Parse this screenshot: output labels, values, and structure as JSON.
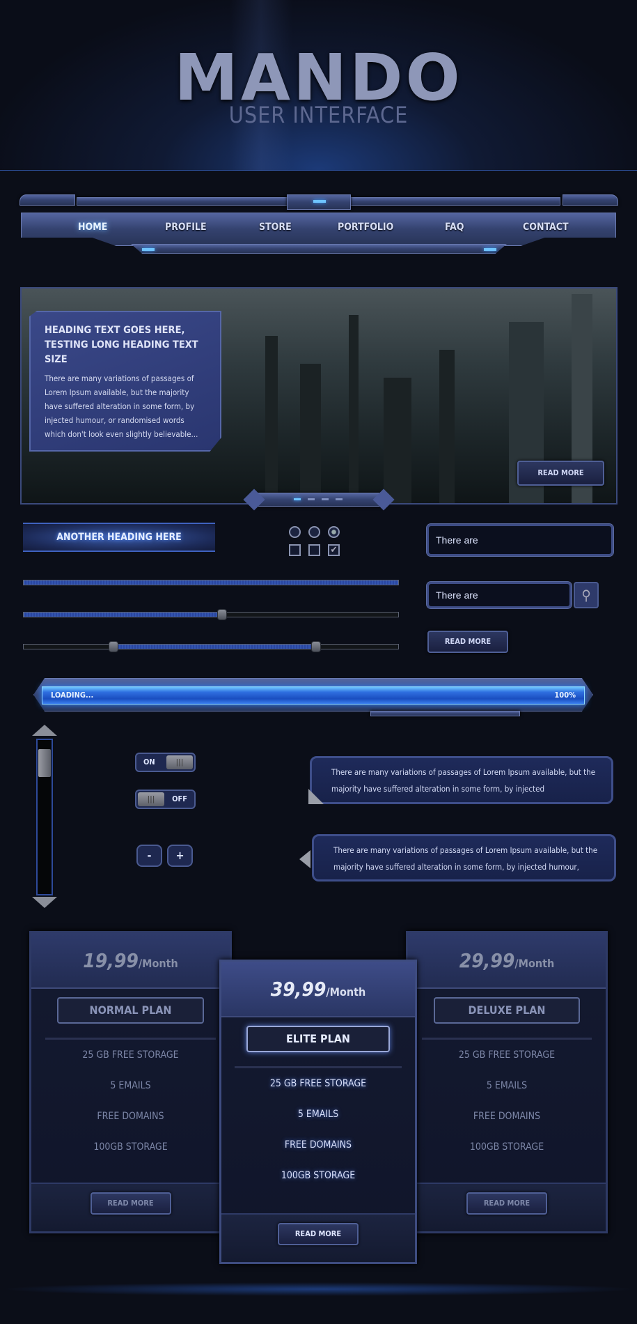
{
  "header": {
    "title": "MANDO",
    "subtitle": "USER INTERFACE"
  },
  "nav": {
    "items": [
      {
        "label": "HOME",
        "active": true
      },
      {
        "label": "PROFILE"
      },
      {
        "label": "STORE"
      },
      {
        "label": "PORTFOLIO"
      },
      {
        "label": "FAQ"
      },
      {
        "label": "CONTACT"
      }
    ]
  },
  "slider": {
    "heading": "HEADING TEXT GOES HERE, TESTING LONG HEADING TEXT SIZE",
    "body": "There are many variations of passages of Lorem Ipsum available, but the majority have suffered alteration in some form, by injected humour, or randomised words which don't look even slightly believable...",
    "read_more": "READ MORE",
    "pages": 4,
    "active_page": 1
  },
  "banner": {
    "heading": "ANOTHER HEADING HERE"
  },
  "radios": {
    "selected": 3
  },
  "checkboxes": {
    "checked": [
      false,
      false,
      true
    ]
  },
  "inputs": {
    "text_value": "There are",
    "search_value": "There are"
  },
  "buttons": {
    "read_more": "READ MORE"
  },
  "range_sliders": {
    "full": 100,
    "single": 53,
    "range": [
      24,
      78
    ]
  },
  "progress": {
    "label": "LOADING...",
    "value_text": "100%",
    "value": 100
  },
  "toggles": {
    "on_label": "ON",
    "off_label": "OFF"
  },
  "stepper": {
    "minus": "-",
    "plus": "+"
  },
  "tooltips": [
    {
      "text": "There are many variations of passages of Lorem Ipsum available, but the majority have suffered alteration in some form, by injected"
    },
    {
      "text": "There are many variations of passages of Lorem Ipsum available, but the majority have suffered alteration in some form, by injected humour,"
    }
  ],
  "pricing": [
    {
      "price": "19,99",
      "period": "/Month",
      "plan": "NORMAL PLAN",
      "features": [
        "25 GB FREE STORAGE",
        "5 EMAILS",
        "FREE DOMAINS",
        "100GB STORAGE"
      ],
      "button": "READ MORE"
    },
    {
      "price": "39,99",
      "period": "/Month",
      "plan": "ELITE PLAN",
      "features": [
        "25 GB FREE STORAGE",
        "5 EMAILS",
        "FREE DOMAINS",
        "100GB STORAGE"
      ],
      "button": "READ MORE"
    },
    {
      "price": "29,99",
      "period": "/Month",
      "plan": "DELUXE PLAN",
      "features": [
        "25 GB FREE STORAGE",
        "5 EMAILS",
        "FREE DOMAINS",
        "100GB STORAGE"
      ],
      "button": "READ MORE"
    }
  ],
  "colors": {
    "accent": "#6fc4ff",
    "panel": "#2e3a6a",
    "background": "#0b0e18"
  }
}
